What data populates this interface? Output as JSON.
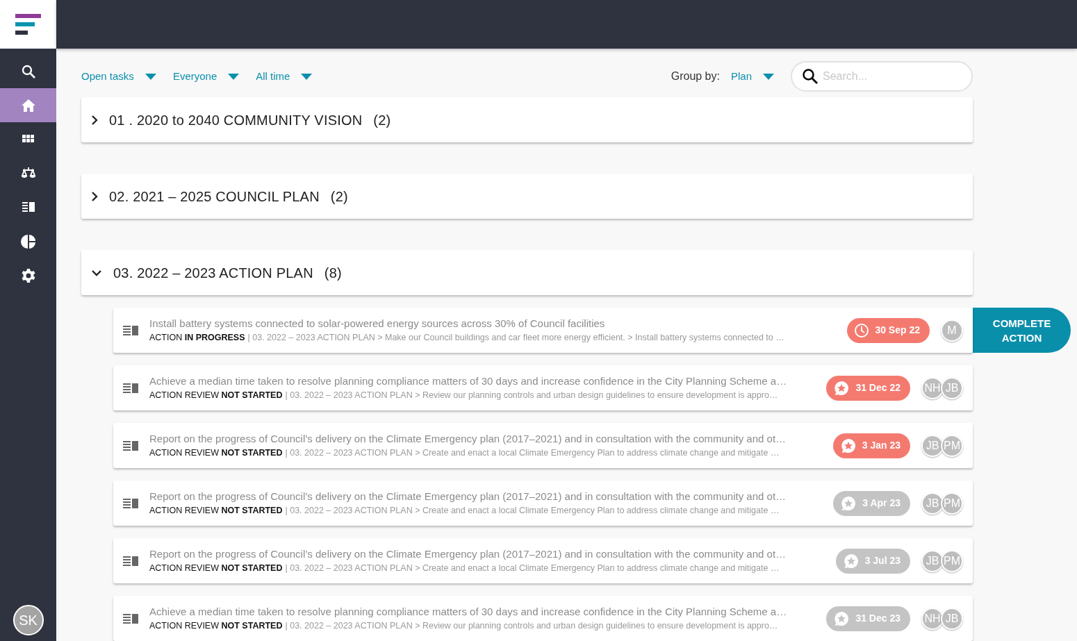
{
  "sidebar": {
    "items": [
      {
        "kind": "search",
        "selected": false
      },
      {
        "kind": "home",
        "selected": true
      },
      {
        "kind": "grid",
        "selected": false
      },
      {
        "kind": "scale",
        "selected": false
      },
      {
        "kind": "list",
        "selected": false
      },
      {
        "kind": "pie",
        "selected": false
      },
      {
        "kind": "settings",
        "selected": false
      }
    ],
    "user": "SK"
  },
  "filters": [
    "Open tasks",
    "Everyone",
    "All time"
  ],
  "group_by": {
    "label": "Group by:",
    "value": "Plan"
  },
  "search": {
    "placeholder": "Search..."
  },
  "groups": [
    {
      "title": "01 . 2020 to 2040 COMMUNITY VISION",
      "count": "(2)",
      "expanded": false
    },
    {
      "title": "02. 2021 – 2025 COUNCIL PLAN",
      "count": "(2)",
      "expanded": false
    },
    {
      "title": "03. 2022 – 2023 ACTION PLAN",
      "count": "(8)",
      "expanded": true,
      "tasks": [
        {
          "title": "Install battery systems connected to solar-powered energy sources across 30% of Council facilities",
          "status": "ACTION **IN PROGRESS**",
          "path": "| 03. 2022 – 2023 ACTION PLAN > Make our Council buildings and car fleet more energy efficient. > Install battery systems connected to …",
          "date": "30 Sep 22",
          "kind": "clock",
          "overdue": true,
          "assignees": [
            "M"
          ],
          "action": "COMPLETE ACTION"
        },
        {
          "title": "Achieve a median time taken to resolve planning compliance matters of 30 days and increase confidence in the City Planning Scheme a…",
          "status": "ACTION REVIEW **NOT STARTED**",
          "path": "| 03. 2022 – 2023 ACTION PLAN > Review our planning controls and urban design guidelines to ensure development is appro…",
          "date": "31 Dec 22",
          "kind": "star",
          "overdue": true,
          "assignees": [
            "NH",
            "JB"
          ]
        },
        {
          "title": "Report on the progress of Council’s delivery on the Climate Emergency plan (2017–2021) and in consultation with the community and ot…",
          "status": "ACTION REVIEW **NOT STARTED**",
          "path": "| 03. 2022 – 2023 ACTION PLAN > Create and enact a local Climate Emergency Plan to address climate change and mitigate …",
          "date": "3 Jan 23",
          "kind": "star",
          "overdue": true,
          "assignees": [
            "JB",
            "PM"
          ]
        },
        {
          "title": "Report on the progress of Council’s delivery on the Climate Emergency plan (2017–2021) and in consultation with the community and ot…",
          "status": "ACTION REVIEW **NOT STARTED**",
          "path": "| 03. 2022 – 2023 ACTION PLAN > Create and enact a local Climate Emergency Plan to address climate change and mitigate …",
          "date": "3 Apr 23",
          "kind": "star",
          "overdue": false,
          "assignees": [
            "JB",
            "PM"
          ]
        },
        {
          "title": "Report on the progress of Council’s delivery on the Climate Emergency plan (2017–2021) and in consultation with the community and ot…",
          "status": "ACTION REVIEW **NOT STARTED**",
          "path": "| 03. 2022 – 2023 ACTION PLAN > Create and enact a local Climate Emergency Plan to address climate change and mitigate …",
          "date": "3 Jul 23",
          "kind": "star",
          "overdue": false,
          "assignees": [
            "JB",
            "PM"
          ]
        },
        {
          "title": "Achieve a median time taken to resolve planning compliance matters of 30 days and increase confidence in the City Planning Scheme a…",
          "status": "ACTION REVIEW **NOT STARTED**",
          "path": "| 03. 2022 – 2023 ACTION PLAN > Review our planning controls and urban design guidelines to ensure development is appro…",
          "date": "31 Dec 23",
          "kind": "star",
          "overdue": false,
          "assignees": [
            "NH",
            "JB"
          ]
        }
      ]
    }
  ]
}
